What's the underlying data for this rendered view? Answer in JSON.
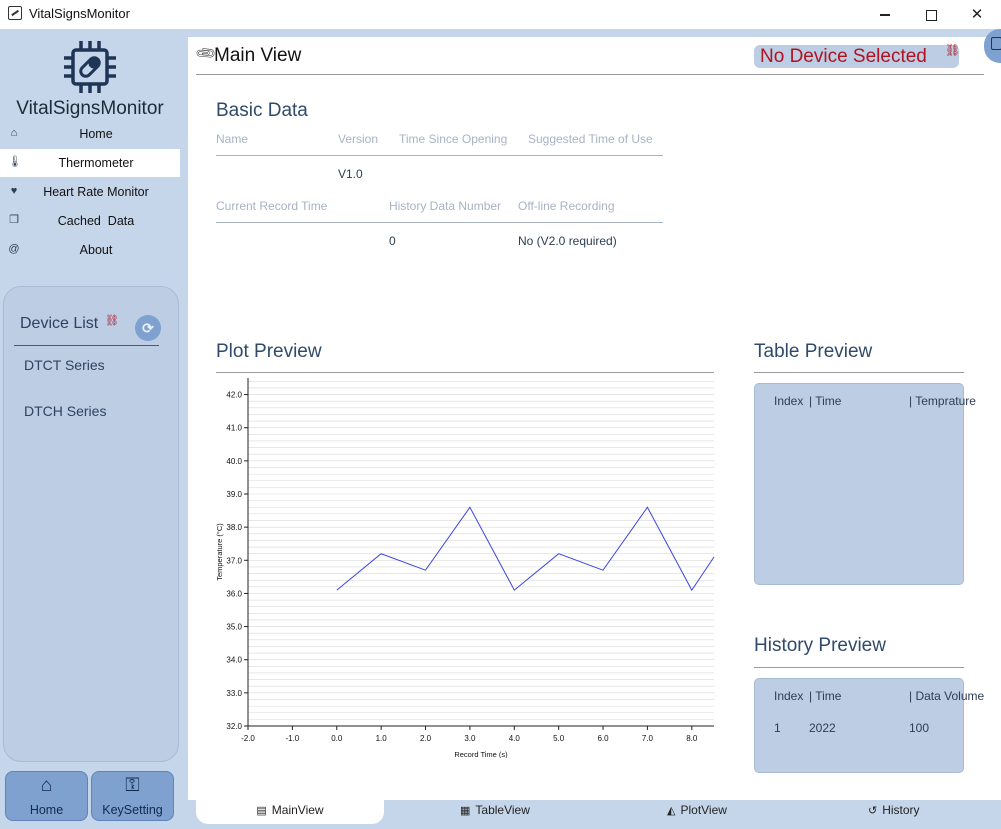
{
  "window": {
    "title": "VitalSignsMonitor"
  },
  "sidebar": {
    "app_name": "VitalSignsMonitor",
    "items": [
      {
        "label": "Home",
        "icon": "home-icon"
      },
      {
        "label": "Thermometer",
        "icon": "thermometer-icon"
      },
      {
        "label": "Heart Rate Monitor",
        "icon": "heartbeat-icon"
      },
      {
        "label": "Cached  Data",
        "icon": "copy-icon"
      },
      {
        "label": "About",
        "icon": "at-icon"
      }
    ]
  },
  "device_list": {
    "title": "Device List",
    "devices": [
      "DTCT Series",
      "DTCH Series"
    ]
  },
  "bottom_buttons": {
    "home": "Home",
    "keysetting": "KeySetting"
  },
  "main": {
    "title": "Main View",
    "status": "No Device Selected"
  },
  "basic_data": {
    "title": "Basic Data",
    "row1_labels": [
      "Name",
      "Version",
      "Time Since Opening",
      "Suggested Time of Use"
    ],
    "row1_values": [
      "",
      "V1.0",
      "",
      ""
    ],
    "row2_labels": [
      "Current Record Time",
      "History Data Number",
      "Off-line Recording"
    ],
    "row2_values": [
      "",
      "0",
      "No (V2.0 required)"
    ]
  },
  "plot_preview": {
    "title": "Plot Preview"
  },
  "table_preview": {
    "title": "Table Preview",
    "headers": [
      "Index",
      "| Time",
      "| Temprature"
    ]
  },
  "history_preview": {
    "title": "History Preview",
    "headers": [
      "Index",
      "| Time",
      "| Data Volume"
    ],
    "rows": [
      [
        "1",
        "2022",
        "100"
      ]
    ]
  },
  "tabs": [
    {
      "label": "MainView",
      "icon": "list-icon"
    },
    {
      "label": "TableView",
      "icon": "table-icon"
    },
    {
      "label": "PlotView",
      "icon": "area-chart-icon"
    },
    {
      "label": "History",
      "icon": "history-icon"
    }
  ],
  "chart_data": {
    "type": "line",
    "xlabel": "Record Time (s)",
    "ylabel": "Temperature (°C)",
    "xlim": [
      -2.0,
      8.5
    ],
    "ylim": [
      32.0,
      42.5
    ],
    "xticks": [
      "-2.0",
      "-1.0",
      "0.0",
      "1.0",
      "2.0",
      "3.0",
      "4.0",
      "5.0",
      "6.0",
      "7.0",
      "8.0"
    ],
    "yticks": [
      "32.0",
      "33.0",
      "34.0",
      "35.0",
      "36.0",
      "37.0",
      "38.0",
      "39.0",
      "40.0",
      "41.0",
      "42.0"
    ],
    "grid": true,
    "series": [
      {
        "color": "#3b46e0",
        "x": [
          0.0,
          1.0,
          2.0,
          3.0,
          4.0,
          5.0,
          6.0,
          7.0,
          8.0,
          8.5
        ],
        "y": [
          36.1,
          37.2,
          36.7,
          38.6,
          36.1,
          37.2,
          36.7,
          38.6,
          36.1,
          37.1
        ]
      }
    ]
  }
}
